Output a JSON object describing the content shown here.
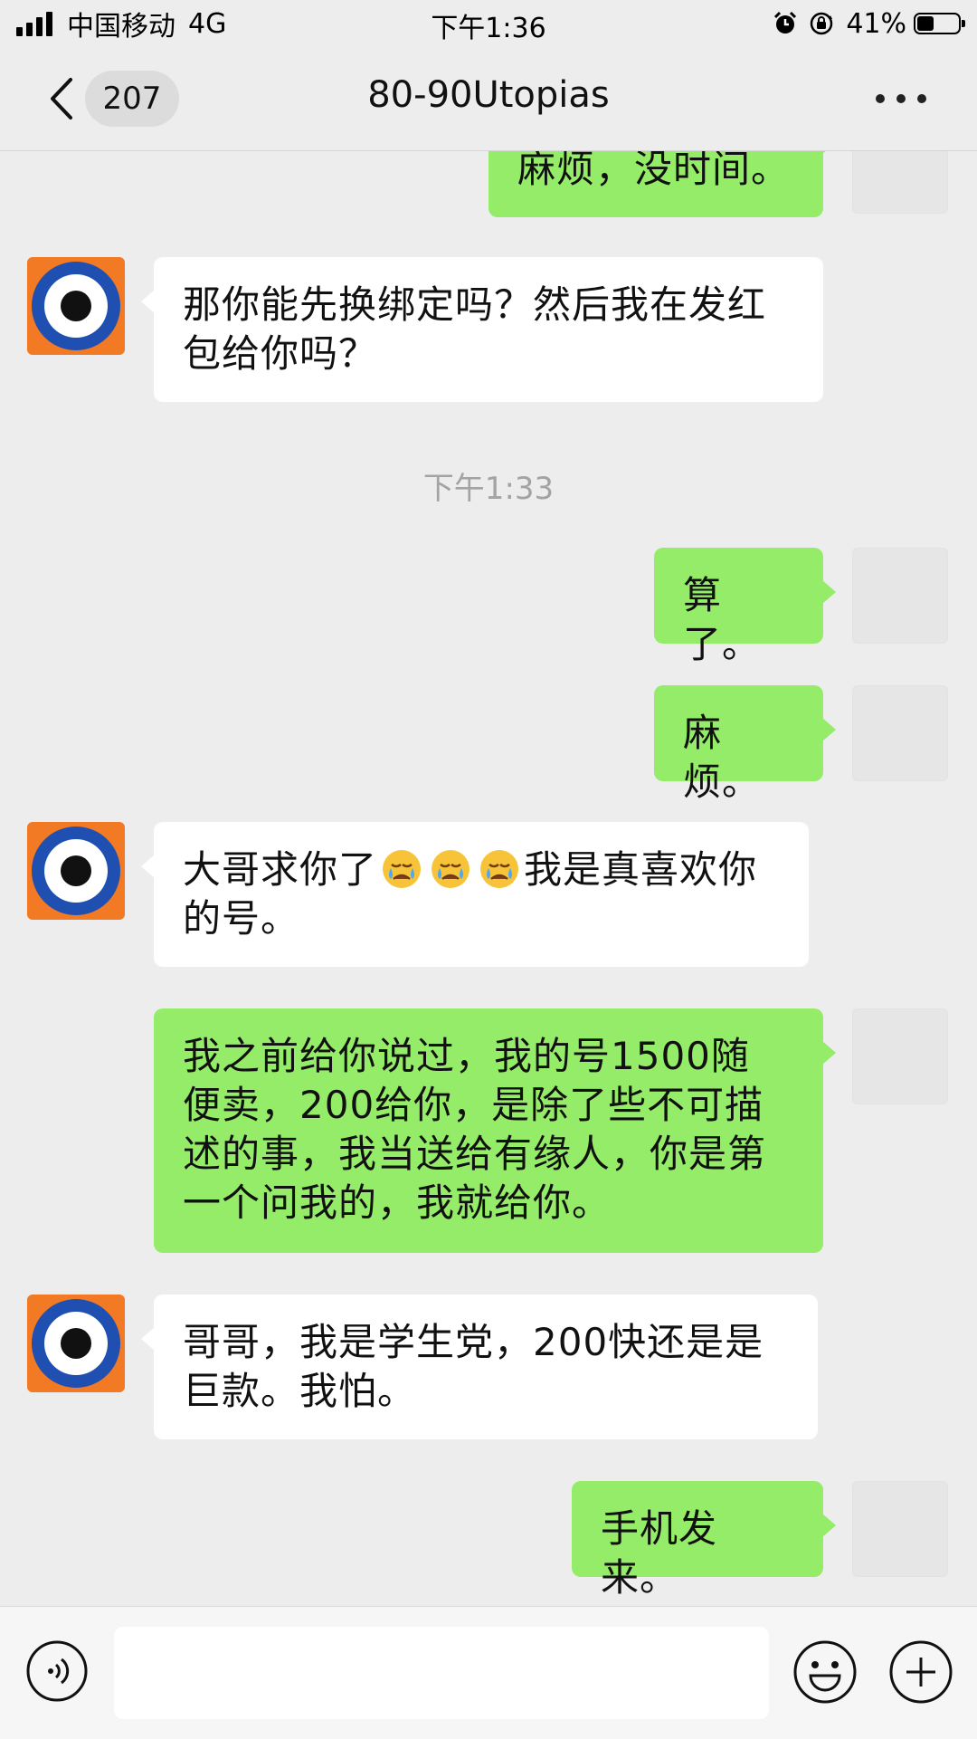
{
  "status_bar": {
    "carrier": "中国移动",
    "network": "4G",
    "time": "下午1:36",
    "battery_percent_label": "41%",
    "battery_level": 0.41
  },
  "nav": {
    "unread_count": "207",
    "title": "80-90Utopias"
  },
  "messages": [
    {
      "side": "out",
      "text": "麻烦，没时间。"
    },
    {
      "side": "in",
      "line1": "那你能先换绑定吗？然后我在发红",
      "line2": "包给你吗？"
    },
    {
      "timestamp": "下午1:33"
    },
    {
      "side": "out",
      "text": "算了。"
    },
    {
      "side": "out",
      "text": "麻烦。"
    },
    {
      "side": "in",
      "pre": "大哥求你了",
      "emoji": "crying-face",
      "post": "我是真喜欢你",
      "line2": "的号。"
    },
    {
      "side": "out",
      "line1": "我之前给你说过，我的号1500随",
      "line2": "便卖，200给你，是除了些不可描",
      "line3": "述的事，我当送给有缘人，你是第",
      "line4": "一个问我的，我就给你。"
    },
    {
      "side": "in",
      "line1": "哥哥，我是学生党，200快还是是",
      "line2": "巨款。我怕。"
    },
    {
      "side": "out",
      "text": "手机发来。"
    }
  ],
  "input_bar": {
    "value": "",
    "icons": [
      "voice-icon",
      "emoji-icon",
      "plus-icon"
    ]
  },
  "colors": {
    "background": "#ededed",
    "outgoing_bubble": "#95ec69",
    "incoming_bubble": "#ffffff",
    "avatar_orange": "#f37a24",
    "avatar_blue": "#1f4fb0",
    "timestamp_text": "#a3a3a3"
  }
}
